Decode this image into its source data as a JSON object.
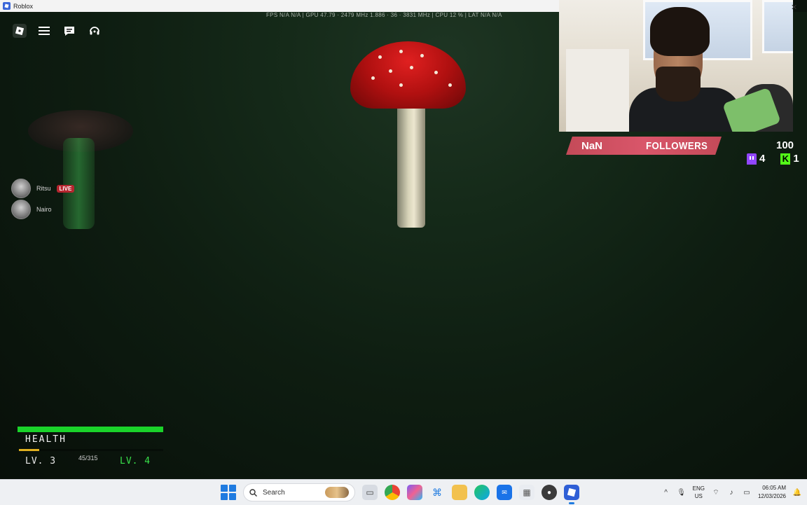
{
  "window": {
    "title": "Roblox"
  },
  "game": {
    "stats_bar": "FPS  N/A  N/A   |   GPU  47.79 · 2479 MHz  1.886 · 36 · 3831 MHz   |   CPU  12 %   |   LAT  N/A  N/A",
    "players": [
      {
        "name": "Ritsu",
        "badge": "LIVE"
      },
      {
        "name": "Nairo",
        "badge": ""
      }
    ],
    "hud": {
      "health_label": "HEALTH",
      "health_fraction": 1.0,
      "level_current": "LV. 3",
      "level_next": "LV. 4",
      "xp_text": "45/315",
      "xp_fraction": 0.143
    },
    "colors": {
      "health": "#1ad32a",
      "xp": "#e0b020",
      "next_level": "#38e04a"
    }
  },
  "stream_overlay": {
    "follower_count": "NaN",
    "follower_label": "FOLLOWERS",
    "goal": "100",
    "twitch_count": "4",
    "kick_count": "1"
  },
  "taskbar": {
    "search_placeholder": "Search",
    "apps": [
      "file-explorer-icon",
      "chrome-icon",
      "copilot-icon",
      "terminal-icon",
      "folder-icon",
      "edge-icon",
      "outlook-icon",
      "store-icon",
      "obs-icon",
      "roblox-icon"
    ],
    "lang_top": "ENG",
    "lang_bottom": "US",
    "time": "06:05 AM",
    "date": "12/03/2026"
  }
}
